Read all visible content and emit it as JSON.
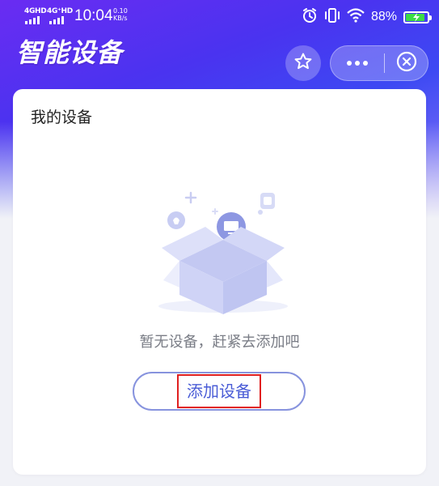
{
  "status_bar": {
    "signal1": "4GHD",
    "signal2": "4G⁺HD",
    "time": "10:04",
    "speed_value": "0.10",
    "speed_unit": "KB/s",
    "battery_percent": "88%"
  },
  "header": {
    "title": "智能设备",
    "favorite_icon": "star-icon",
    "more_icon": "more-icon",
    "close_icon": "close-circle-icon"
  },
  "card": {
    "title": "我的设备",
    "empty_message": "暂无设备，赶紧去添加吧",
    "add_button_label": "添加设备"
  },
  "colors": {
    "header_gradient_start": "#6a2cf2",
    "header_gradient_end": "#3d49f3",
    "accent": "#4a5cd6",
    "highlight": "#e02020",
    "battery": "#3ddc46"
  }
}
